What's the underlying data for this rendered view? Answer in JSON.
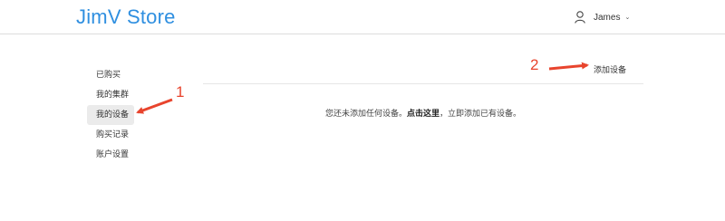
{
  "header": {
    "brand": "JimV Store",
    "user_name": "James",
    "user_icon": "user-icon",
    "caret_icon": "chevron-down-icon"
  },
  "sidebar": {
    "items": [
      {
        "label": "已购买"
      },
      {
        "label": "我的集群"
      },
      {
        "label": "我的设备",
        "active": true
      },
      {
        "label": "购买记录"
      },
      {
        "label": "账户设置"
      }
    ]
  },
  "main": {
    "add_device_label": "添加设备",
    "empty_before": "您还未添加任何设备。",
    "empty_link": "点击这里",
    "empty_after": "，立即添加已有设备。"
  },
  "annotations": {
    "num_1": "1",
    "num_2": "2",
    "color": "#e8442d"
  },
  "colors": {
    "brand": "#2f8fe0",
    "active_item_bg": "#ebebeb"
  }
}
